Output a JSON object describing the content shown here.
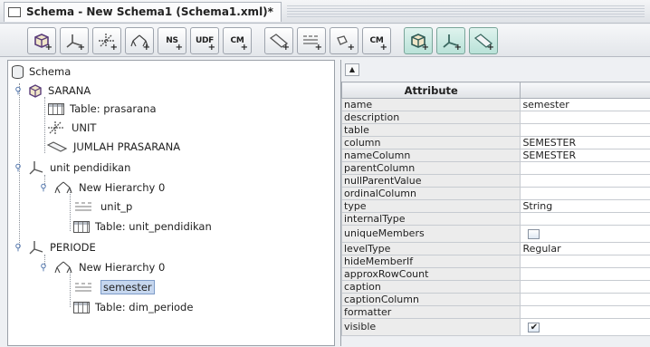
{
  "window": {
    "title": "Schema - New Schema1 (Schema1.xml)*"
  },
  "toolbar": {
    "buttons": [
      {
        "name": "add-cube",
        "icon": "cube-icon"
      },
      {
        "name": "add-dimension",
        "icon": "dimension-icon"
      },
      {
        "name": "add-dimension-usage",
        "icon": "dimension-usage-icon"
      },
      {
        "name": "add-hierarchy",
        "icon": "hierarchy-icon"
      },
      {
        "name": "add-named-set",
        "text": "NS"
      },
      {
        "name": "add-user-defined-function",
        "text": "UDF"
      },
      {
        "name": "add-calculated-member",
        "text": "CM"
      },
      {
        "name": "add-measure",
        "icon": "measure-icon"
      },
      {
        "name": "add-level",
        "icon": "level-icon"
      },
      {
        "name": "add-property",
        "icon": "property-icon"
      },
      {
        "name": "add-calculated-member-2",
        "text": "CM"
      },
      {
        "name": "add-virtual-cube",
        "icon": "cube-icon"
      },
      {
        "name": "add-virtual-dimension",
        "icon": "dimension-icon"
      },
      {
        "name": "add-virtual-measure",
        "icon": "measure-icon"
      }
    ]
  },
  "tree": {
    "root": "Schema",
    "nodes": [
      {
        "label": "SARANA",
        "icon": "cube-icon"
      },
      {
        "label": "Table: prasarana",
        "icon": "table-icon"
      },
      {
        "label": "UNIT",
        "icon": "dimension-usage-icon"
      },
      {
        "label": "JUMLAH PRASARANA",
        "icon": "measure-icon"
      },
      {
        "label": "unit pendidikan",
        "icon": "dimension-icon"
      },
      {
        "label": "New Hierarchy 0",
        "icon": "hierarchy-icon"
      },
      {
        "label": "unit_p",
        "icon": "level-icon"
      },
      {
        "label": "Table: unit_pendidikan",
        "icon": "table-icon"
      },
      {
        "label": "PERIODE",
        "icon": "dimension-icon"
      },
      {
        "label": "New Hierarchy 0",
        "icon": "hierarchy-icon"
      },
      {
        "label": "semester",
        "icon": "level-icon",
        "selected": true
      },
      {
        "label": "Table: dim_periode",
        "icon": "table-icon"
      }
    ]
  },
  "attributes": {
    "header": "Attribute",
    "rows": [
      {
        "name": "name",
        "value": "semester"
      },
      {
        "name": "description",
        "value": ""
      },
      {
        "name": "table",
        "value": ""
      },
      {
        "name": "column",
        "value": "SEMESTER"
      },
      {
        "name": "nameColumn",
        "value": "SEMESTER"
      },
      {
        "name": "parentColumn",
        "value": ""
      },
      {
        "name": "nullParentValue",
        "value": ""
      },
      {
        "name": "ordinalColumn",
        "value": ""
      },
      {
        "name": "type",
        "value": "String"
      },
      {
        "name": "internalType",
        "value": ""
      },
      {
        "name": "uniqueMembers",
        "value": "",
        "checkbox": false
      },
      {
        "name": "levelType",
        "value": "Regular"
      },
      {
        "name": "hideMemberIf",
        "value": ""
      },
      {
        "name": "approxRowCount",
        "value": ""
      },
      {
        "name": "caption",
        "value": ""
      },
      {
        "name": "captionColumn",
        "value": ""
      },
      {
        "name": "formatter",
        "value": ""
      },
      {
        "name": "visible",
        "value": "",
        "checkbox": true
      }
    ]
  }
}
